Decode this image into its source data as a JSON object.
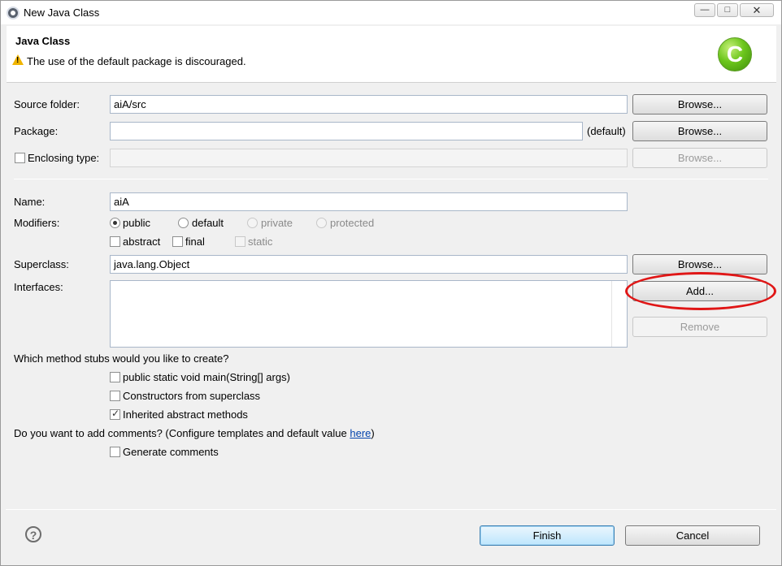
{
  "window": {
    "title": "New Java Class"
  },
  "header": {
    "title": "Java Class",
    "message": "The use of the default package is discouraged."
  },
  "form": {
    "source_folder": {
      "label": "Source folder:",
      "value": "aiA/src",
      "browse": "Browse..."
    },
    "package": {
      "label": "Package:",
      "value": "",
      "suffix": "(default)",
      "browse": "Browse..."
    },
    "enclosing_type": {
      "label": "Enclosing type:",
      "value": "",
      "browse": "Browse..."
    },
    "name": {
      "label": "Name:",
      "value": "aiA"
    },
    "modifiers": {
      "label": "Modifiers:",
      "radios": [
        "public",
        "default",
        "private",
        "protected"
      ],
      "checks": [
        "abstract",
        "final",
        "static"
      ]
    },
    "superclass": {
      "label": "Superclass:",
      "value": "java.lang.Object",
      "browse": "Browse..."
    },
    "interfaces": {
      "label": "Interfaces:",
      "add": "Add...",
      "remove": "Remove"
    },
    "stubs": {
      "question": "Which method stubs would you like to create?",
      "options": [
        "public static void main(String[] args)",
        "Constructors from superclass",
        "Inherited abstract methods"
      ]
    },
    "comments": {
      "question_prefix": "Do you want to add comments? (Configure templates and default value ",
      "link": "here",
      "question_suffix": ")",
      "option": "Generate comments"
    }
  },
  "footer": {
    "help": "?",
    "finish": "Finish",
    "cancel": "Cancel"
  }
}
